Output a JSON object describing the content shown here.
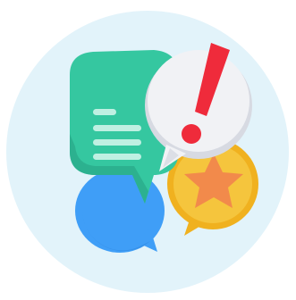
{
  "illustration": {
    "subject": "feedback-alert-chat-bubbles",
    "icons": [
      "chat-bubble-icon",
      "speech-bubble-icon",
      "star-review-icon",
      "exclamation-alert-icon"
    ],
    "colors": {
      "background_circle": "#e2f3fa",
      "green_bubble": "#35c7a0",
      "green_bubble_shadow": "#2aa887",
      "green_bubble_lines": "#bff0e2",
      "blue_bubble": "#3f9ef7",
      "blue_bubble_shadow": "#2f86de",
      "yellow_bubble": "#f5c53d",
      "yellow_bubble_rim": "#f0b11f",
      "star": "#f28a4b",
      "white_bubble": "#f1f2f5",
      "white_bubble_shadow": "#d7dae2",
      "alert": "#ef2b3b"
    }
  }
}
